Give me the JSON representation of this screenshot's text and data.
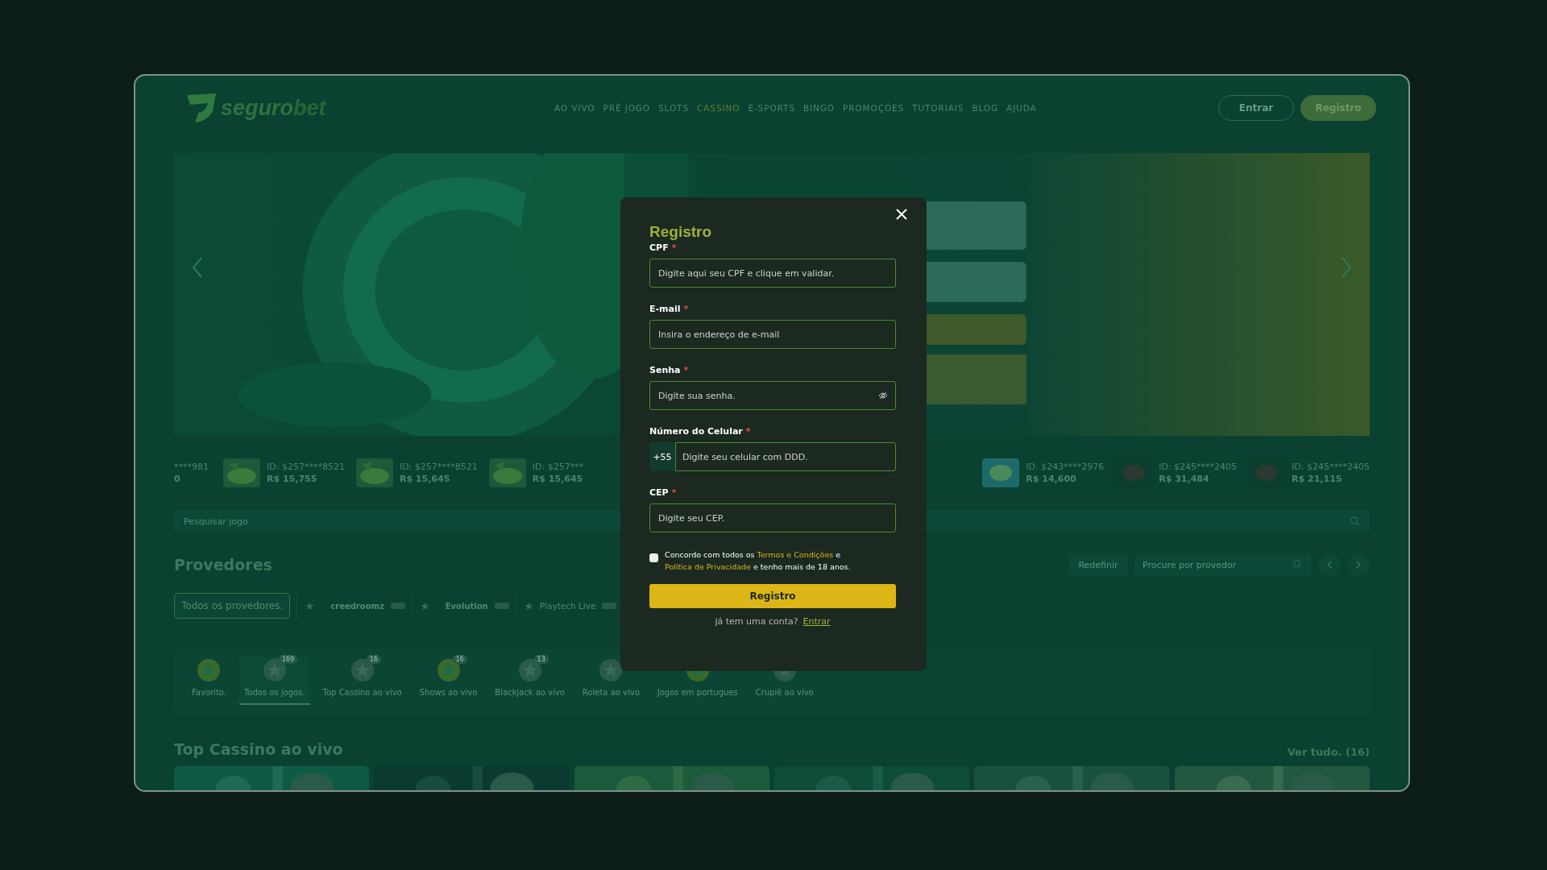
{
  "logo": {
    "main": "seguro",
    "accent": "bet"
  },
  "nav": [
    {
      "label": "AO VIVO",
      "selected": false
    },
    {
      "label": "PRÉ JOGO",
      "selected": false
    },
    {
      "label": "SLOTS",
      "selected": false
    },
    {
      "label": "CASSINO",
      "selected": true
    },
    {
      "label": "E-SPORTS",
      "selected": false
    },
    {
      "label": "BINGO",
      "selected": false
    },
    {
      "label": "PROMOÇÕES",
      "selected": false
    },
    {
      "label": "TUTORIAIS",
      "selected": false
    },
    {
      "label": "BLOG",
      "selected": false
    },
    {
      "label": "AJUDA",
      "selected": false
    }
  ],
  "header_buttons": {
    "login": "Entrar",
    "register": "Registro"
  },
  "ticker_left": [
    {
      "id": "****981",
      "amount": "0"
    },
    {
      "id": "ID: $257****8521",
      "amount": "R$ 15,755"
    },
    {
      "id": "ID: $257****8521",
      "amount": "R$ 15,645"
    },
    {
      "id": "ID: $257***",
      "amount": "R$ 15,645"
    }
  ],
  "ticker_right": [
    {
      "id": "ID: $243****2976",
      "amount": "R$ 14,600"
    },
    {
      "id": "ID: $245****2405",
      "amount": "R$ 31,484"
    },
    {
      "id": "ID: $245****2405",
      "amount": "R$ 21,115"
    }
  ],
  "game_search": {
    "placeholder": "Pesquisar jogo"
  },
  "providers": {
    "title": "Provedores",
    "reset": "Redefinir",
    "search_placeholder": "Procure por provedor",
    "chips": [
      {
        "kind": "all",
        "label": "Todos os provedores.",
        "selected": true
      },
      {
        "kind": "logo",
        "label": "creedroomz",
        "selected": false
      },
      {
        "kind": "logo",
        "label": "Evolution",
        "selected": false
      },
      {
        "kind": "text",
        "label": "Playtech Live",
        "selected": false
      }
    ]
  },
  "categories": [
    {
      "label": "Favorito.",
      "selected": false
    },
    {
      "label": "Todos os jogos.",
      "count": "169",
      "selected": true
    },
    {
      "label": "Top Cassino ao vivo",
      "count": "16",
      "selected": false
    },
    {
      "label": "Shows ao vivo",
      "count": "16",
      "selected": false
    },
    {
      "label": "Blackjack ao vivo",
      "count": "13",
      "selected": false
    },
    {
      "label": "Roleta ao vivo",
      "selected": false
    },
    {
      "label": "Jogos em portugues",
      "selected": false
    },
    {
      "label": "Crupiê ao vivo",
      "selected": false
    }
  ],
  "top_section": {
    "title": "Top Cassino ao vivo",
    "see_all": "Ver tudo. (16)"
  },
  "modal": {
    "title": "Registro",
    "fields": [
      {
        "kind": "text",
        "label": "CPF",
        "asterisk": "*",
        "placeholder": "Digite aqui seu CPF e clique em validar."
      },
      {
        "kind": "text",
        "label": "E-mail",
        "asterisk": "*",
        "placeholder": "Insira o endereço de e-mail"
      },
      {
        "kind": "password",
        "label": "Senha",
        "asterisk": "*",
        "placeholder": "Digite sua senha."
      },
      {
        "kind": "phone",
        "label": "Número do Celular",
        "asterisk": "*",
        "prefix": "+55",
        "placeholder": "Digite seu celular com DDD."
      },
      {
        "kind": "text",
        "label": "CEP",
        "asterisk": "*",
        "placeholder": "Digite seu CEP."
      }
    ],
    "terms": {
      "checked": false,
      "before": "Concordo com todos os ",
      "link1": "Termos e Condições",
      "middle": " e ",
      "link2": "Política de Privacidade",
      "after": " e tenho mais de 18 anos."
    },
    "submit": "Registro",
    "login_prompt": "já tem uma conta?",
    "login_link": "Entrar"
  }
}
